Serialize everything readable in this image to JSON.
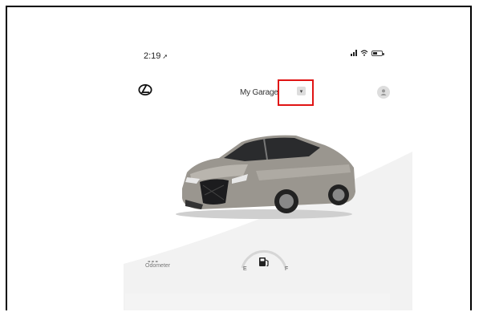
{
  "status_bar": {
    "time": "2:19",
    "location_arrow": "➚"
  },
  "header": {
    "title": "My Garage",
    "dropdown_icon": "chevron-down",
    "logo_icon": "lexus-logo",
    "profile_icon": "person"
  },
  "vehicle": {
    "image": "silver Lexus ES sedan"
  },
  "stats": {
    "odometer_value": "---",
    "odometer_label": "Odometer",
    "fuel_empty_label": "E",
    "fuel_full_label": "F",
    "fuel_icon": "fuel-pump"
  },
  "colors": {
    "highlight": "#e01414"
  }
}
